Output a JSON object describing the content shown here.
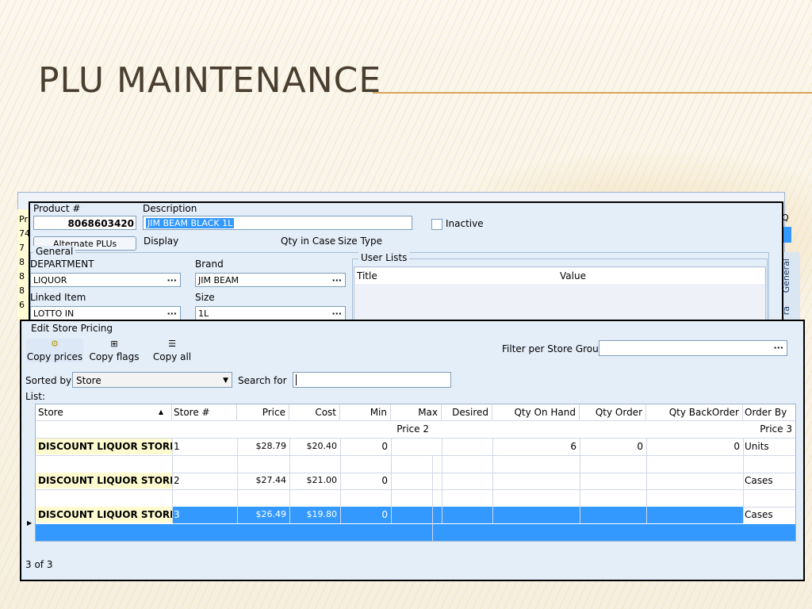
{
  "slide": {
    "title": "PLU MAINTENANCE"
  },
  "product": {
    "number_label": "Product #",
    "number": "8068603420",
    "description_label": "Description",
    "description": "JIM BEAM BLACK 1L",
    "inactive_label": "Inactive",
    "alternate_plus_label": "Alternate PLUs",
    "display_label": "Display",
    "qty_in_case_label": "Qty in Case",
    "size_type_label": "Size Type"
  },
  "general": {
    "title": "General",
    "department_label": "DEPARTMENT",
    "department": "LIQUOR",
    "brand_label": "Brand",
    "brand": "JIM BEAM",
    "linked_item_label": "Linked Item",
    "linked_item": "LOTTO IN",
    "size_label": "Size",
    "size": "1L",
    "user_lists": {
      "title": "User Lists",
      "col_title": "Title",
      "col_value": "Value"
    }
  },
  "side_tabs": [
    "General",
    "ra"
  ],
  "side_q": "Q",
  "left_rows": [
    "Pr",
    "74",
    "7",
    "8",
    "8",
    "8",
    "6"
  ],
  "pricing": {
    "title": "Edit Store Pricing",
    "buttons": [
      {
        "label": "Copy prices",
        "icon": "copy-prices-icon",
        "glyph": "⚙"
      },
      {
        "label": "Copy flags",
        "icon": "copy-flags-icon",
        "glyph": "⊞"
      },
      {
        "label": "Copy all",
        "icon": "copy-all-icon",
        "glyph": "☰"
      }
    ],
    "filter_label": "Filter per Store Group",
    "filter_value": "",
    "sorted_by_label": "Sorted by",
    "sorted_by": "Store",
    "search_label": "Search for",
    "search_value": "",
    "list_label": "List:",
    "columns": [
      "Store",
      "Store #",
      "Price",
      "Cost",
      "Min",
      "Max",
      "Desired",
      "Qty On Hand",
      "Qty Order",
      "Qty BackOrder",
      "Order By"
    ],
    "subheaders": {
      "price2": "Price 2",
      "price3": "Price 3"
    },
    "rows": [
      {
        "store": "DISCOUNT LIQUOR STORE :",
        "store_no": "1",
        "price": "$28.79",
        "cost": "$20.40",
        "min": "0",
        "max": "",
        "desired": "",
        "qty_on_hand": "6",
        "qty_order": "0",
        "qty_backorder": "0",
        "order_by": "Units"
      },
      {
        "store": "DISCOUNT LIQUOR STORE :",
        "store_no": "2",
        "price": "$27.44",
        "cost": "$21.00",
        "min": "0",
        "max": "",
        "desired": "",
        "qty_on_hand": "",
        "qty_order": "",
        "qty_backorder": "",
        "order_by": "Cases"
      },
      {
        "store": "DISCOUNT LIQUOR STORE :",
        "store_no": "3",
        "price": "$26.49",
        "cost": "$19.80",
        "min": "0",
        "max": "",
        "desired": "",
        "qty_on_hand": "",
        "qty_order": "",
        "qty_backorder": "",
        "order_by": "Cases"
      }
    ],
    "count": "3 of 3"
  },
  "colors": {
    "selection": "#3399ff",
    "store_highlight": "#fffbd0",
    "title_rule": "#d9a45a"
  }
}
